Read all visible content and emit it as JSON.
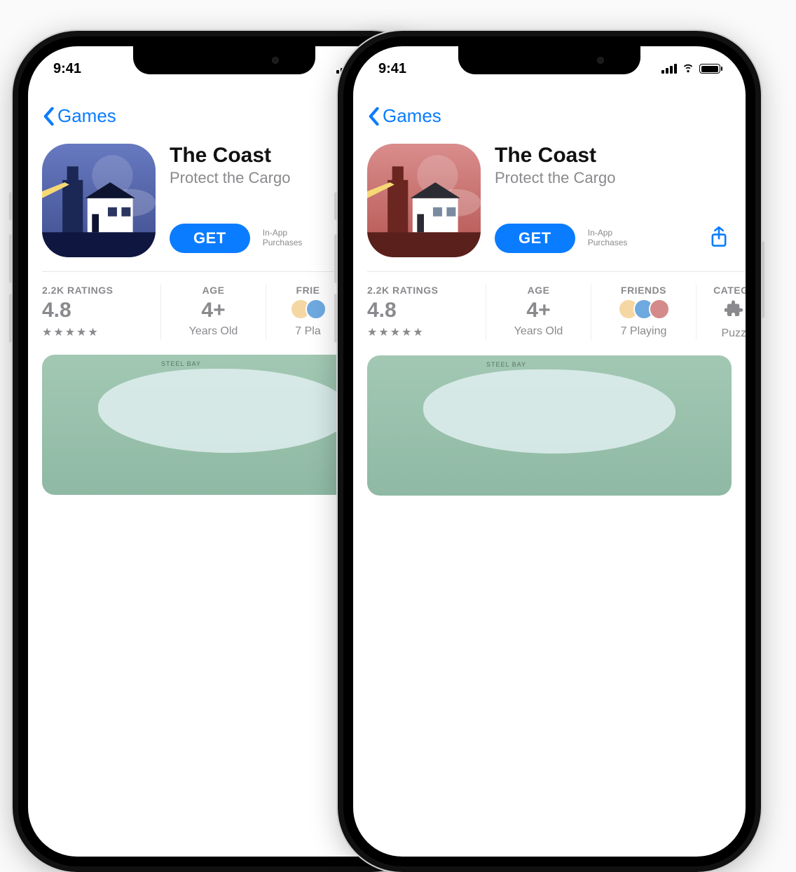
{
  "status_time": "9:41",
  "nav_back": "Games",
  "app": {
    "title": "The Coast",
    "subtitle": "Protect the Cargo",
    "get_label": "GET",
    "iap_line1": "In-App",
    "iap_line2": "Purchases"
  },
  "stats": {
    "ratings": {
      "label": "2.2K RATINGS",
      "value": "4.8",
      "stars": "★★★★★"
    },
    "age": {
      "label": "AGE",
      "value": "4+",
      "sub": "Years Old"
    },
    "friends": {
      "label": "FRIENDS",
      "sub": "7 Playing",
      "label_short": "FRIE"
    },
    "category": {
      "label": "CATEGO",
      "sub": "Puzzl"
    }
  },
  "screenshot_label": "STEEL BAY",
  "avatars": [
    "#f4d7a3",
    "#6ea9e0",
    "#d48a8a"
  ],
  "accent": "#0a7cff"
}
